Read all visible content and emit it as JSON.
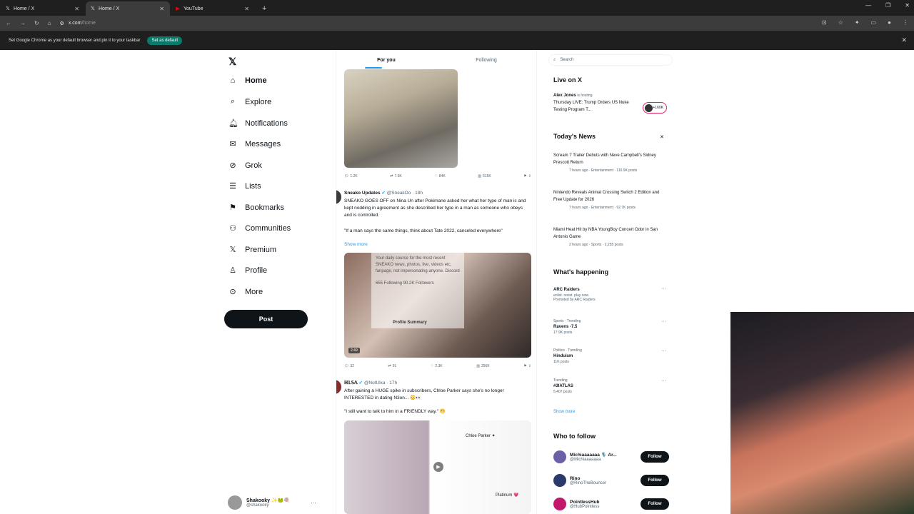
{
  "browser": {
    "tabs": [
      {
        "title": "Home / X",
        "active": false
      },
      {
        "title": "Home / X",
        "active": true
      },
      {
        "title": "YouTube",
        "active": false
      }
    ],
    "url": "x.com/home",
    "url_host": "x.com",
    "url_path": "/home",
    "infobar_text": "Set Google Chrome as your default browser and pin it to your taskbar",
    "infobar_button": "Set as default"
  },
  "nav": {
    "items": [
      {
        "label": "Home",
        "icon": "home-icon"
      },
      {
        "label": "Explore",
        "icon": "search-icon"
      },
      {
        "label": "Notifications",
        "icon": "bell-icon"
      },
      {
        "label": "Messages",
        "icon": "mail-icon"
      },
      {
        "label": "Grok",
        "icon": "grok-icon"
      },
      {
        "label": "Lists",
        "icon": "list-icon"
      },
      {
        "label": "Bookmarks",
        "icon": "bookmark-icon"
      },
      {
        "label": "Communities",
        "icon": "people-icon"
      },
      {
        "label": "Premium",
        "icon": "x-icon"
      },
      {
        "label": "Profile",
        "icon": "user-icon"
      },
      {
        "label": "More",
        "icon": "more-icon"
      }
    ],
    "post_button": "Post",
    "account_name": "Shakooky ✨🐸🍭",
    "account_handle": "@shakooky"
  },
  "feed": {
    "tabs": [
      "For you",
      "Following"
    ],
    "tweet0_actions": {
      "replies": "1.2K",
      "reposts": "7.6K",
      "likes": "84K",
      "views": "615K"
    },
    "tweet1": {
      "name": "Sneako Updates",
      "handle": "@SneakOo · 18h",
      "text1": "SNEAKO GOES OFF on Nina Un after Pokimane asked her what her type of man is and kept nodding in agreement as she described her type in a man as someone who obeys and is controlled.",
      "text2": "\"If a man says the same things, think about Tate 2022, canceled everywhere\"",
      "show_more": "Show more",
      "duration": "2:49",
      "actions": {
        "replies": "32",
        "reposts": "91",
        "likes": "2.3K",
        "views": "256K"
      }
    },
    "hovercard": {
      "bio": "Your daily source for the most recent SNEAKO news, photos, live, videos etc. fanpage, not impersonating anyone. Discord",
      "stats": "655 Following   90.2K Followers",
      "profile_summary": "Profile Summary"
    },
    "tweet2": {
      "name": "ℍ𝕃𝕊𝔸",
      "handle": "@NotUlxa · 17h",
      "text1": "After gaining a HUGE spike in subscribers, Chloe Parker says she's no longer INTERESTED in dating N3on... 😳👀",
      "text2": "\"I still want to talk to him in a FRIENDLY way.\" 😬",
      "card_name": "Chloe Parker ✦",
      "card_label": "Platinum 💗"
    }
  },
  "right": {
    "search_placeholder": "Search",
    "live_title": "Live on X",
    "live_host": "Alex Jones",
    "live_host_suffix": "is hosting",
    "live_text": "Thursday LIVE: Trump Orders US Nuke Testing Program T...",
    "live_count": "+160K",
    "news_title": "Today's News",
    "news": [
      {
        "headline": "Scream 7 Trailer Debuts with Neve Campbell's Sidney Prescott Return",
        "meta": "7 hours ago · Entertainment · 116.9K posts"
      },
      {
        "headline": "Nintendo Reveals Animal Crossing Switch 2 Edition and Free Update for 2026",
        "meta": "7 hours ago · Entertainment · 92.7K posts"
      },
      {
        "headline": "Miami Heat Hit by NBA YoungBoy Concert Odor in San Antonio Game",
        "meta": "2 hours ago · Sports · 2,255 posts"
      }
    ],
    "happening_title": "What's happening",
    "trends": [
      {
        "context": "",
        "topic": "ARC Raiders",
        "sub": "enlist. resist. play now.",
        "meta": "Promoted by ARC Raiders"
      },
      {
        "context": "Sports · Trending",
        "topic": "Ravens -7.5",
        "sub": "",
        "meta": "17.9K posts"
      },
      {
        "context": "Politics · Trending",
        "topic": "Hinduism",
        "sub": "",
        "meta": "11K posts"
      },
      {
        "context": "Trending",
        "topic": "#3IATLAS",
        "sub": "",
        "meta": "5,407 posts"
      }
    ],
    "show_more": "Show more",
    "wtf_title": "Who to follow",
    "follow": [
      {
        "name": "Michiaaaaaaa 🎙️ Ar...",
        "handle": "@Michiaaaaaaa",
        "button": "Follow"
      },
      {
        "name": "Rino",
        "handle": "@RinoTheBouncer",
        "button": "Follow"
      },
      {
        "name": "PointlessHub",
        "handle": "@HubPointless",
        "button": "Follow"
      }
    ]
  }
}
